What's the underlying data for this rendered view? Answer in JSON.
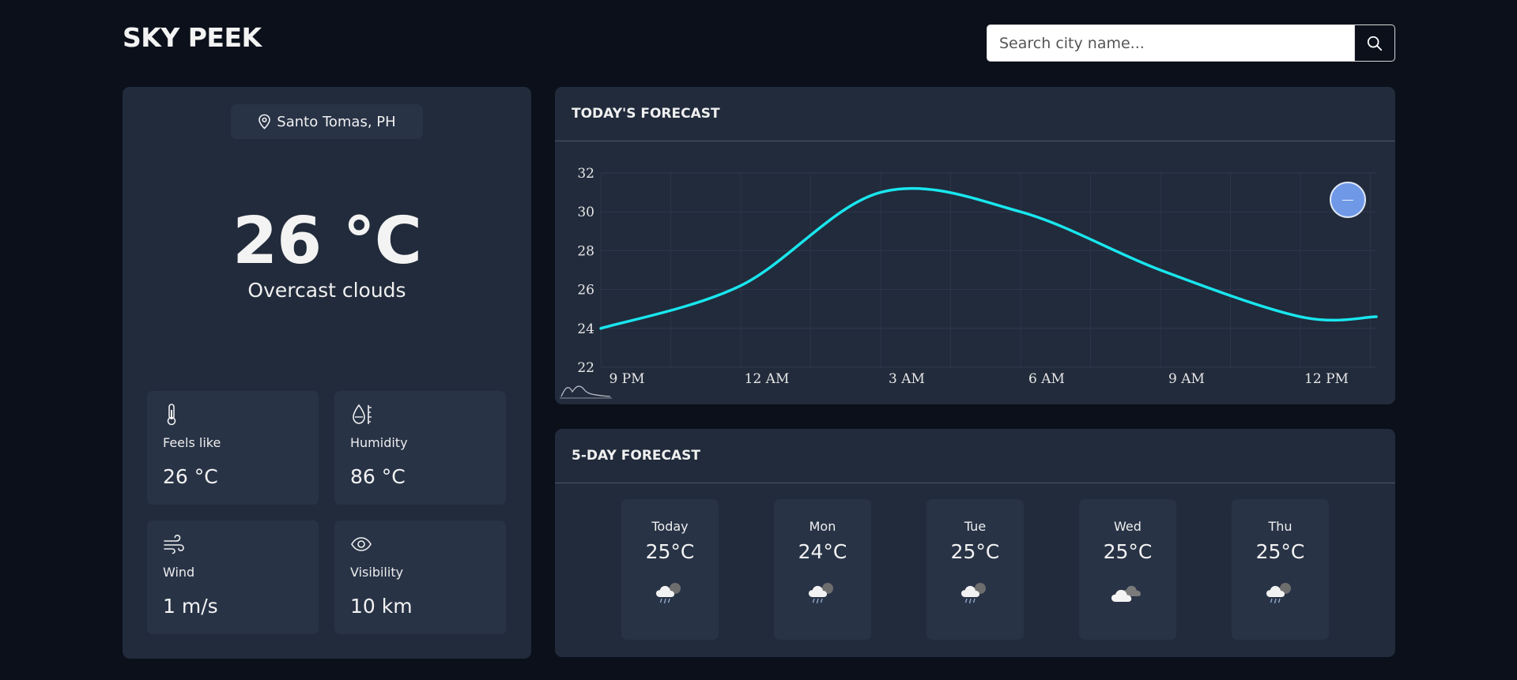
{
  "app": {
    "title": "SKY PEEK"
  },
  "search": {
    "placeholder": "Search city name...",
    "value": "",
    "button_icon": "search-icon"
  },
  "current": {
    "location": "Santo Tomas, PH",
    "temperature": "26 °C",
    "condition": "Overcast clouds",
    "stats": [
      {
        "icon": "thermometer-icon",
        "label": "Feels like",
        "value": "26 °C"
      },
      {
        "icon": "humidity-icon",
        "label": "Humidity",
        "value": "86 °C"
      },
      {
        "icon": "wind-icon",
        "label": "Wind",
        "value": "1 m/s"
      },
      {
        "icon": "eye-icon",
        "label": "Visibility",
        "value": "10 km"
      }
    ]
  },
  "today": {
    "title": "TODAY'S FORECAST"
  },
  "chart_data": {
    "type": "line",
    "title": "",
    "xlabel": "",
    "ylabel": "",
    "x": [
      "9 PM",
      "12 AM",
      "3 AM",
      "6 AM",
      "9 AM",
      "12 PM"
    ],
    "series": [
      {
        "values": [
          24.0,
          26.2,
          31.0,
          30.0,
          27.0,
          24.6
        ],
        "color": "#19e6ee"
      }
    ],
    "ylim": [
      22,
      32
    ],
    "yticks": [
      22,
      24,
      26,
      28,
      30,
      32
    ],
    "grid": true
  },
  "week": {
    "title": "5-DAY FORECAST",
    "days": [
      {
        "name": "Today",
        "temp": "25°C",
        "icon": "rain-cloud-icon"
      },
      {
        "name": "Mon",
        "temp": "24°C",
        "icon": "rain-cloud-icon"
      },
      {
        "name": "Tue",
        "temp": "25°C",
        "icon": "rain-cloud-icon"
      },
      {
        "name": "Wed",
        "temp": "25°C",
        "icon": "overcast-cloud-icon"
      },
      {
        "name": "Thu",
        "temp": "25°C",
        "icon": "rain-cloud-icon"
      }
    ]
  },
  "colors": {
    "background": "#0b101b",
    "card": "#212b3b",
    "tile": "#283346",
    "line": "#19e6ee",
    "toggle": "#6f98e6"
  }
}
